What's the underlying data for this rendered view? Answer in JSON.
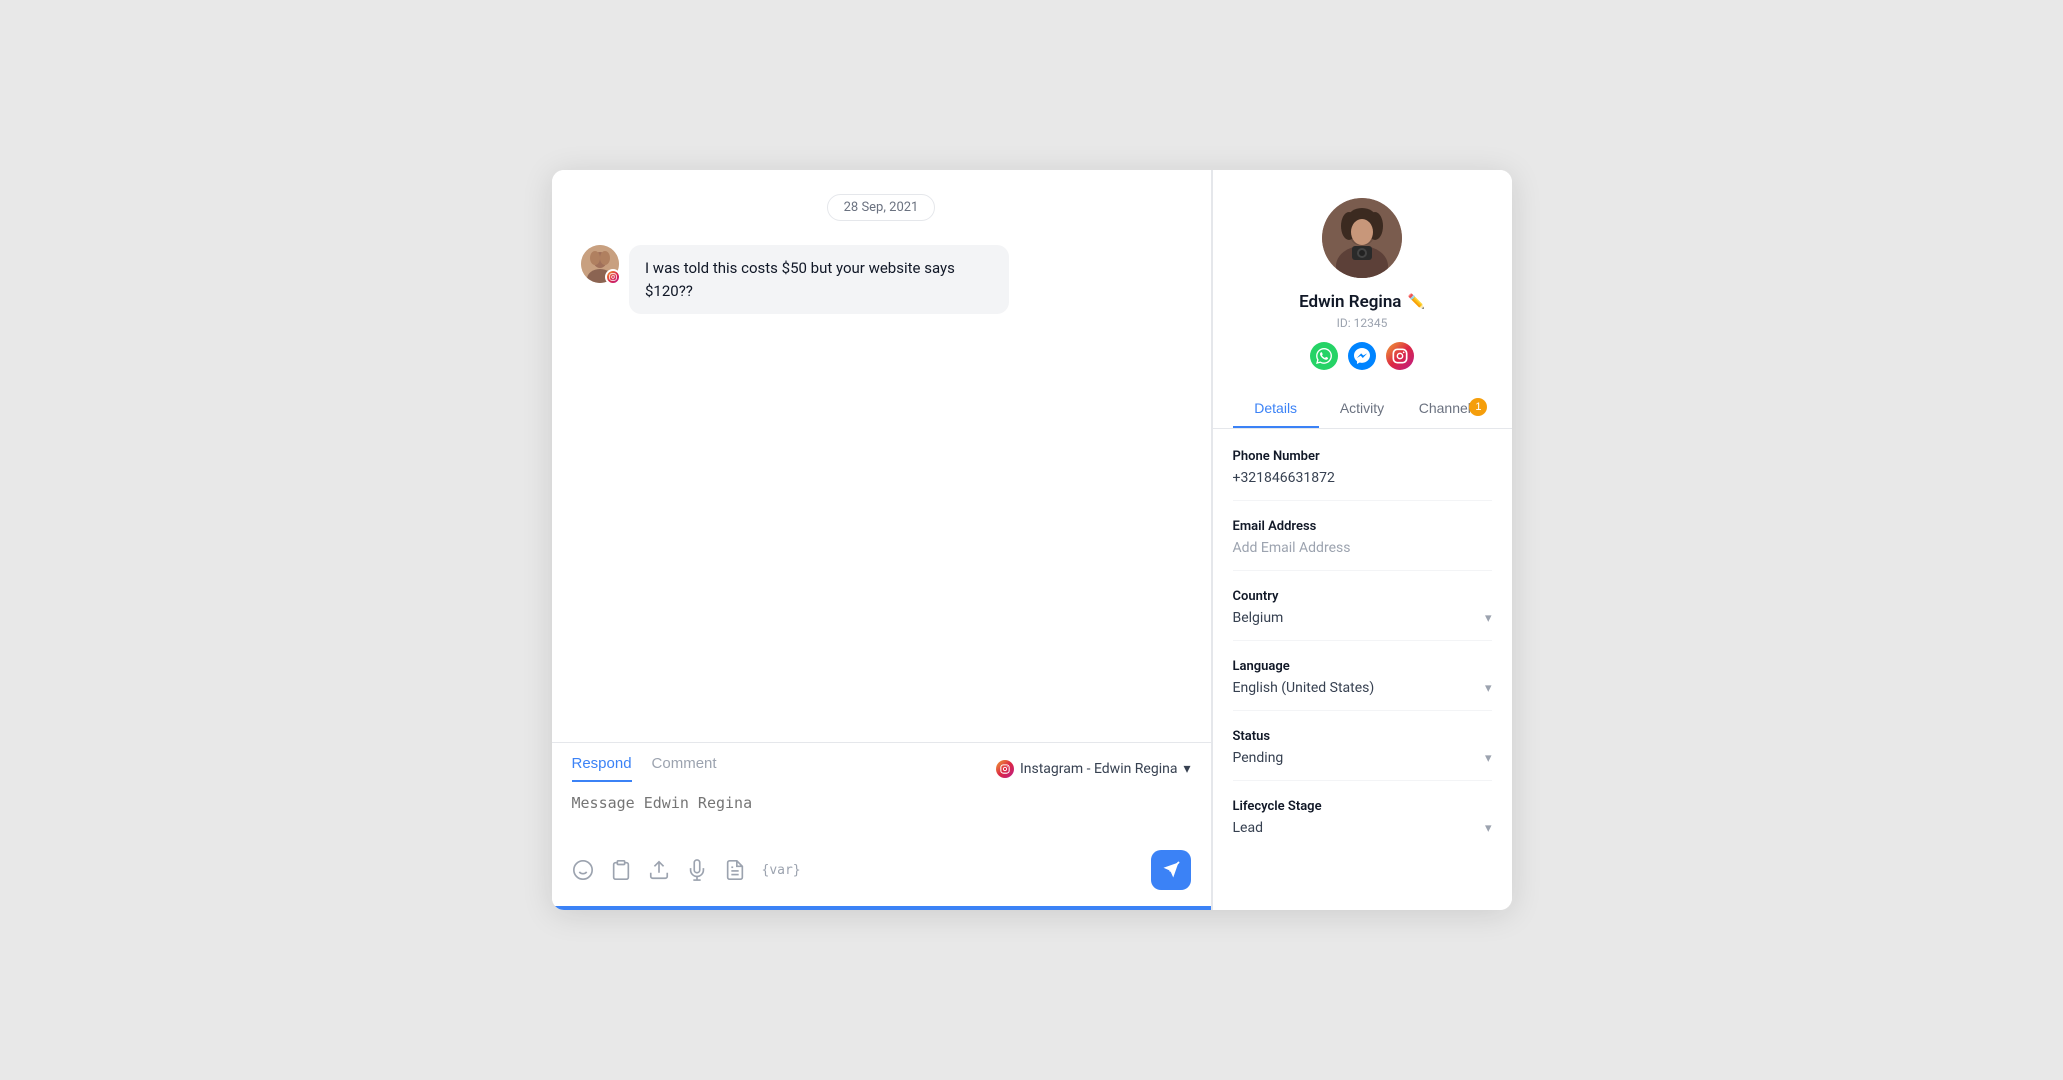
{
  "date_badge": "28 Sep, 2021",
  "message": {
    "text": "I was told this costs $50 but your website says $120??"
  },
  "reply": {
    "respond_tab": "Respond",
    "comment_tab": "Comment",
    "channel": "Instagram - Edwin Regina",
    "placeholder": "Message Edwin Regina",
    "send_label": "Send"
  },
  "toolbar_icons": {
    "emoji": "😊",
    "clipboard": "📋",
    "upload": "⬆",
    "mic": "🎤",
    "doc": "📄",
    "var": "{var}"
  },
  "contact": {
    "name": "Edwin Regina",
    "id_label": "ID: 12345",
    "tabs": [
      "Details",
      "Activity",
      "Channels"
    ],
    "channels_badge": "1",
    "phone_label": "Phone Number",
    "phone_value": "+321846631872",
    "email_label": "Email Address",
    "email_placeholder": "Add Email Address",
    "country_label": "Country",
    "country_value": "Belgium",
    "language_label": "Language",
    "language_value": "English (United States)",
    "status_label": "Status",
    "status_value": "Pending",
    "lifecycle_label": "Lifecycle Stage",
    "lifecycle_value": "Lead"
  }
}
